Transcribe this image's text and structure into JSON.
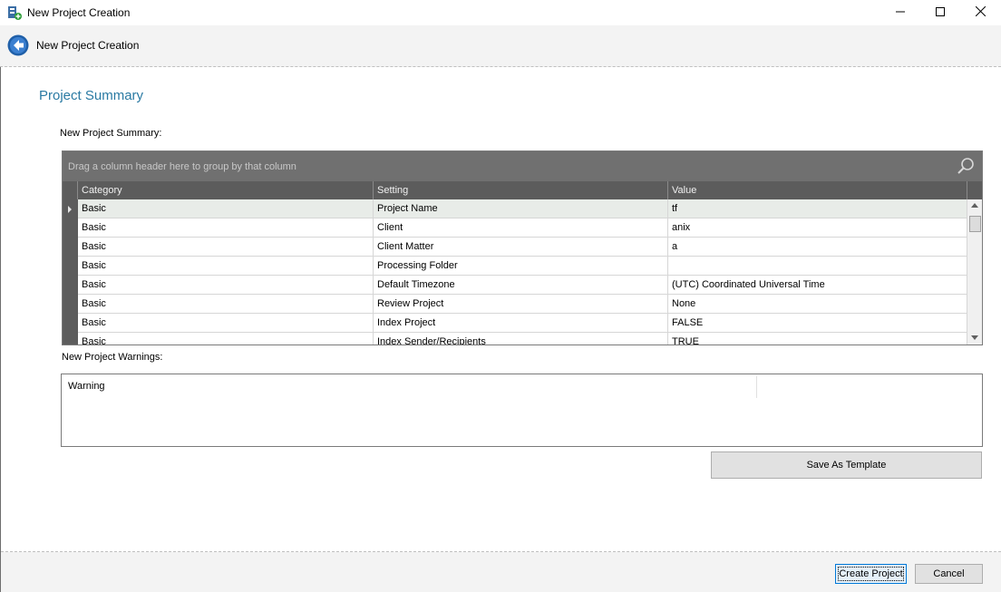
{
  "window": {
    "title": "New Project Creation"
  },
  "header": {
    "title": "New Project Creation"
  },
  "page": {
    "section_title": "Project Summary",
    "summary_label": "New Project Summary:",
    "warnings_label": "New Project Warnings:"
  },
  "grid": {
    "group_panel_text": "Drag a column header here to group by that column",
    "columns": [
      "Category",
      "Setting",
      "Value"
    ],
    "rows": [
      [
        "Basic",
        "Project Name",
        "tf"
      ],
      [
        "Basic",
        "Client",
        "anix"
      ],
      [
        "Basic",
        "Client Matter",
        "a"
      ],
      [
        "Basic",
        "Processing Folder",
        ""
      ],
      [
        "Basic",
        "Default Timezone",
        "(UTC) Coordinated Universal Time"
      ],
      [
        "Basic",
        "Review Project",
        "None"
      ],
      [
        "Basic",
        "Index Project",
        "FALSE"
      ],
      [
        "Basic",
        "Index Sender/Recipients",
        "TRUE"
      ]
    ],
    "selected_row": 0
  },
  "warnings": {
    "column_header": "Warning"
  },
  "buttons": {
    "save_template": "Save As Template",
    "create_project": "Create Project",
    "cancel": "Cancel"
  },
  "colors": {
    "accent": "#2a7aa3",
    "grid_header": "#5c5c5c",
    "group_panel": "#707070",
    "focus_border": "#0078d7"
  }
}
